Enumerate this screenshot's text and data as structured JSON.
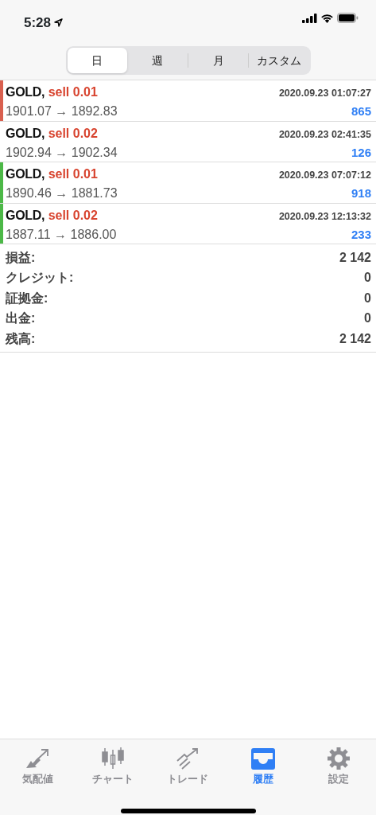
{
  "status_bar": {
    "time": "5:28"
  },
  "segments": [
    {
      "label": "日",
      "selected": true
    },
    {
      "label": "週",
      "selected": false
    },
    {
      "label": "月",
      "selected": false
    },
    {
      "label": "カスタム",
      "selected": false
    }
  ],
  "trades": [
    {
      "symbol": "GOLD,",
      "order": "sell 0.01",
      "time": "2020.09.23 01:07:27",
      "prices": "1901.07 → 1892.83",
      "profit": "865",
      "color": "#d9604f"
    },
    {
      "symbol": "GOLD,",
      "order": "sell 0.02",
      "time": "2020.09.23 02:41:35",
      "prices": "1902.94 → 1902.34",
      "profit": "126"
    },
    {
      "symbol": "GOLD,",
      "order": "sell 0.01",
      "time": "2020.09.23 07:07:12",
      "prices": "1890.46 → 1881.73",
      "profit": "918",
      "color": "#4cb847"
    },
    {
      "symbol": "GOLD,",
      "order": "sell 0.02",
      "time": "2020.09.23 12:13:32",
      "prices": "1887.11 → 1886.00",
      "profit": "233",
      "color": "#4cb847"
    }
  ],
  "summary": [
    {
      "label": "損益:",
      "value": "2 142"
    },
    {
      "label": "クレジット:",
      "value": "0"
    },
    {
      "label": "証拠金:",
      "value": "0"
    },
    {
      "label": "出金:",
      "value": "0"
    },
    {
      "label": "残高:",
      "value": "2 142"
    }
  ],
  "tab_bar": [
    {
      "kind": "quotes",
      "label": "気配値",
      "selected": false
    },
    {
      "kind": "chart",
      "label": "チャート",
      "selected": false
    },
    {
      "kind": "trade",
      "label": "トレード",
      "selected": false
    },
    {
      "kind": "history",
      "label": "履歴",
      "selected": true
    },
    {
      "kind": "settings",
      "label": "設定",
      "selected": false
    }
  ]
}
